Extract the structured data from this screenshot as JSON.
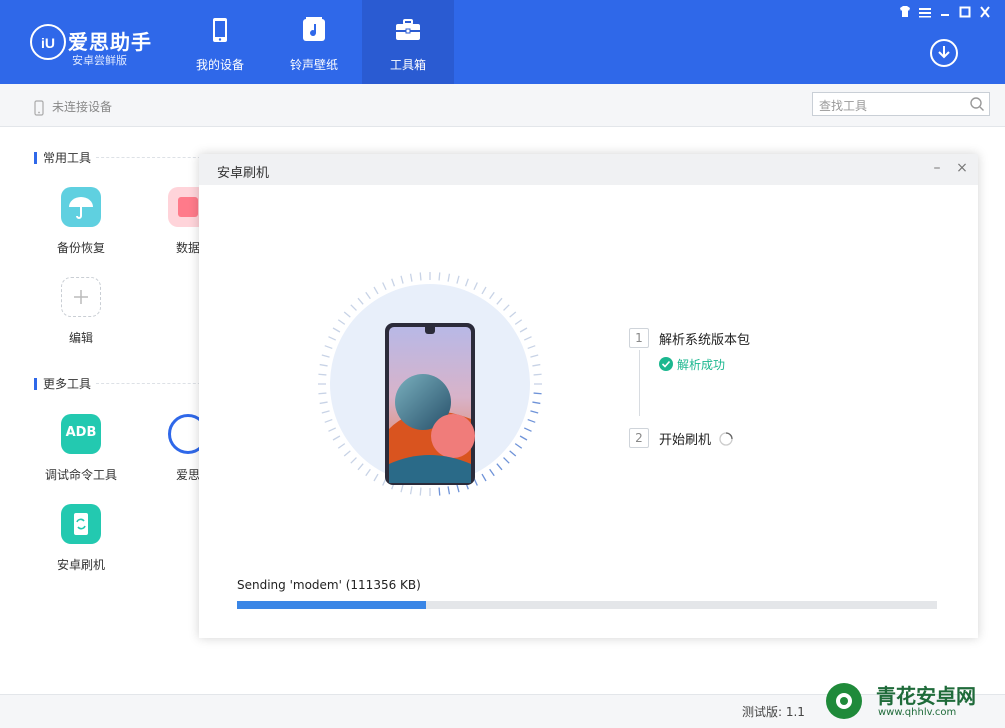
{
  "app": {
    "name": "爱思助手",
    "edition": "安卓尝鲜版"
  },
  "nav": [
    {
      "label": "我的设备",
      "icon": "phone-icon"
    },
    {
      "label": "铃声壁纸",
      "icon": "music-icon"
    },
    {
      "label": "工具箱",
      "icon": "toolbox-icon",
      "active": true
    }
  ],
  "device_status": "未连接设备",
  "search": {
    "placeholder": "查找工具"
  },
  "sections": {
    "common": {
      "title": "常用工具",
      "tools": [
        {
          "label": "备份恢复",
          "icon": "umbrella-icon",
          "color": "#5fd0e0"
        },
        {
          "label": "数据",
          "icon": "data-icon",
          "color": "#ff7a8a"
        },
        {
          "label": "编辑",
          "icon": "plus-icon"
        }
      ]
    },
    "more": {
      "title": "更多工具",
      "tools": [
        {
          "label": "调试命令工具",
          "icon": "adb-icon",
          "icon_text": "ADB",
          "color": "#23c9b0"
        },
        {
          "label": "爱思",
          "icon": "aisi-icon",
          "color": "#2f68e9"
        },
        {
          "label": "安卓刷机",
          "icon": "android-flash-icon",
          "color": "#23c9b0"
        }
      ]
    }
  },
  "dialog": {
    "title": "安卓刷机",
    "steps": [
      {
        "num": "1",
        "label": "解析系统版本包",
        "status": "解析成功"
      },
      {
        "num": "2",
        "label": "开始刷机"
      }
    ],
    "progress": {
      "label": "Sending 'modem' (111356 KB)",
      "percent": 27
    }
  },
  "footer": {
    "version": "测试版: 1.1"
  },
  "watermark": {
    "title": "青花安卓网",
    "url": "www.qhhlv.com"
  },
  "colors": {
    "brand": "#2f68e9",
    "success": "#1bb78f",
    "progress": "#3a86e6"
  }
}
